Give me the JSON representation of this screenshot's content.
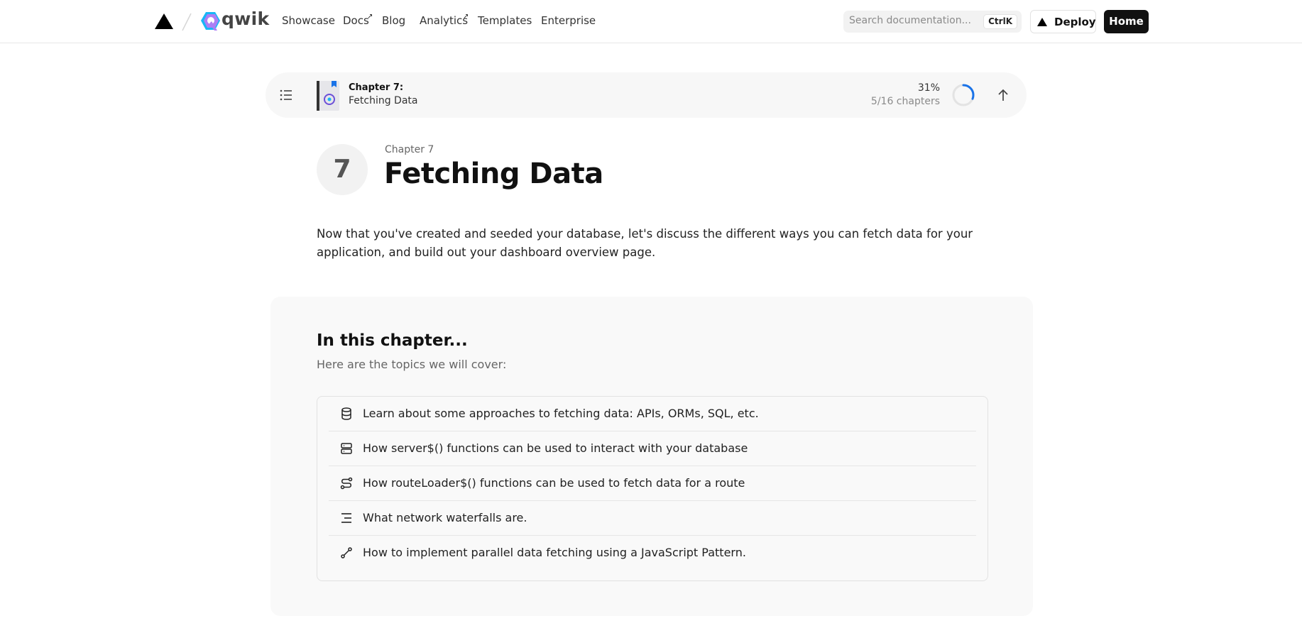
{
  "nav": {
    "brand": "qwik",
    "links": [
      {
        "label": "Showcase",
        "external": false
      },
      {
        "label": "Docs",
        "external": true
      },
      {
        "label": "Blog",
        "external": false
      },
      {
        "label": "Analytics",
        "external": true
      },
      {
        "label": "Templates",
        "external": false
      },
      {
        "label": "Enterprise",
        "external": false
      }
    ],
    "external_glyph": "↗",
    "search": {
      "placeholder": "Search documentation...",
      "shortcut": "CtrlK"
    },
    "deploy_label": "Deploy",
    "home_label": "Home"
  },
  "chapter_bar": {
    "title": "Chapter 7:",
    "subtitle": "Fetching Data",
    "percent_label": "31%",
    "progress_fraction": 0.31,
    "chapters_label": "5/16 chapters",
    "accent": "#1a73e8",
    "icons": [
      "list-icon",
      "book-thumbnail-icon",
      "arrow-up-icon"
    ]
  },
  "chapter": {
    "number": "7",
    "kicker": "Chapter 7",
    "title": "Fetching Data",
    "intro": "Now that you've created and seeded your database, let's discuss the different ways you can fetch data for your application, and build out your dashboard overview page."
  },
  "overview": {
    "heading": "In this chapter...",
    "subheading": "Here are the topics we will cover:",
    "topics": [
      {
        "icon": "database-icon",
        "text": "Learn about some approaches to fetching data: APIs, ORMs, SQL, etc."
      },
      {
        "icon": "server-icon",
        "text": "How server$() functions can be used to interact with your database"
      },
      {
        "icon": "route-icon",
        "text": "How routeLoader$() functions can be used to fetch data for a route"
      },
      {
        "icon": "waterfall-icon",
        "text": "What network waterfalls are."
      },
      {
        "icon": "parallel-icon",
        "text": "How to implement parallel data fetching using a JavaScript Pattern."
      }
    ]
  }
}
